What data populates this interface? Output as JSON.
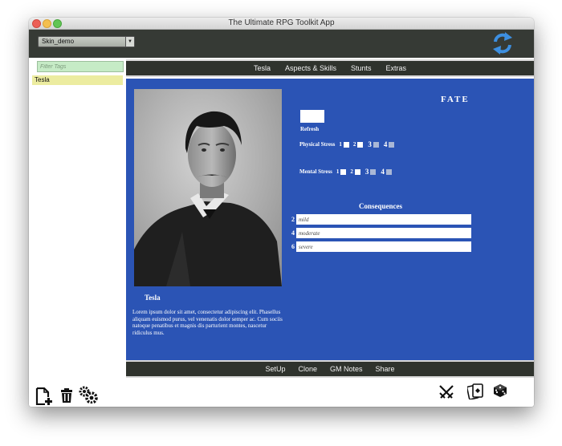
{
  "window": {
    "title": "The Ultimate RPG Toolkit App"
  },
  "topbar": {
    "skin_value": "Skin_demo"
  },
  "sidebar": {
    "filter_placeholder": "Filter Tags",
    "items": [
      {
        "label": "Tesla"
      }
    ]
  },
  "nav": {
    "tabs": [
      "Tesla",
      "Aspects & Skills",
      "Stunts",
      "Extras"
    ]
  },
  "sheet": {
    "system_title": "FATE",
    "character_name": "Tesla",
    "bio": "Lorem ipsum dolor sit amet, consectetur adipiscing elit. Phasellus aliquam euismod purus, vel venenatis dolor semper ac. Cum sociis natoque penatibus et magnis dis parturient montes, nascetur ridiculus mus.",
    "refresh_label": "Refresh",
    "physical_stress": {
      "label": "Physical Stress",
      "boxes": [
        {
          "n": "1",
          "checked": false
        },
        {
          "n": "2",
          "checked": false
        },
        {
          "n": "3",
          "checked": false
        },
        {
          "n": "4",
          "checked": false
        }
      ]
    },
    "mental_stress": {
      "label": "Mental Stress",
      "boxes": [
        {
          "n": "1",
          "checked": false
        },
        {
          "n": "2",
          "checked": false
        },
        {
          "n": "3",
          "checked": false
        },
        {
          "n": "4",
          "checked": false
        }
      ]
    },
    "consequences": {
      "title": "Consequences",
      "rows": [
        {
          "shift": "2",
          "placeholder": "mild"
        },
        {
          "shift": "4",
          "placeholder": "moderate"
        },
        {
          "shift": "6",
          "placeholder": "severe"
        }
      ]
    }
  },
  "bottom_nav": {
    "tabs": [
      "SetUp",
      "Clone",
      "GM Notes",
      "Share"
    ]
  },
  "colors": {
    "sheet_bg": "#2b54b5",
    "bar_bg": "#2f332d",
    "topbar_bg": "#363a35",
    "filter_bg": "#c6ebc6",
    "selected_item_bg": "#ececa0"
  },
  "icons": [
    "refresh-icon",
    "new-document-icon",
    "trash-icon",
    "gears-icon",
    "crossed-swords-icon",
    "cards-icon",
    "dice-icon"
  ]
}
